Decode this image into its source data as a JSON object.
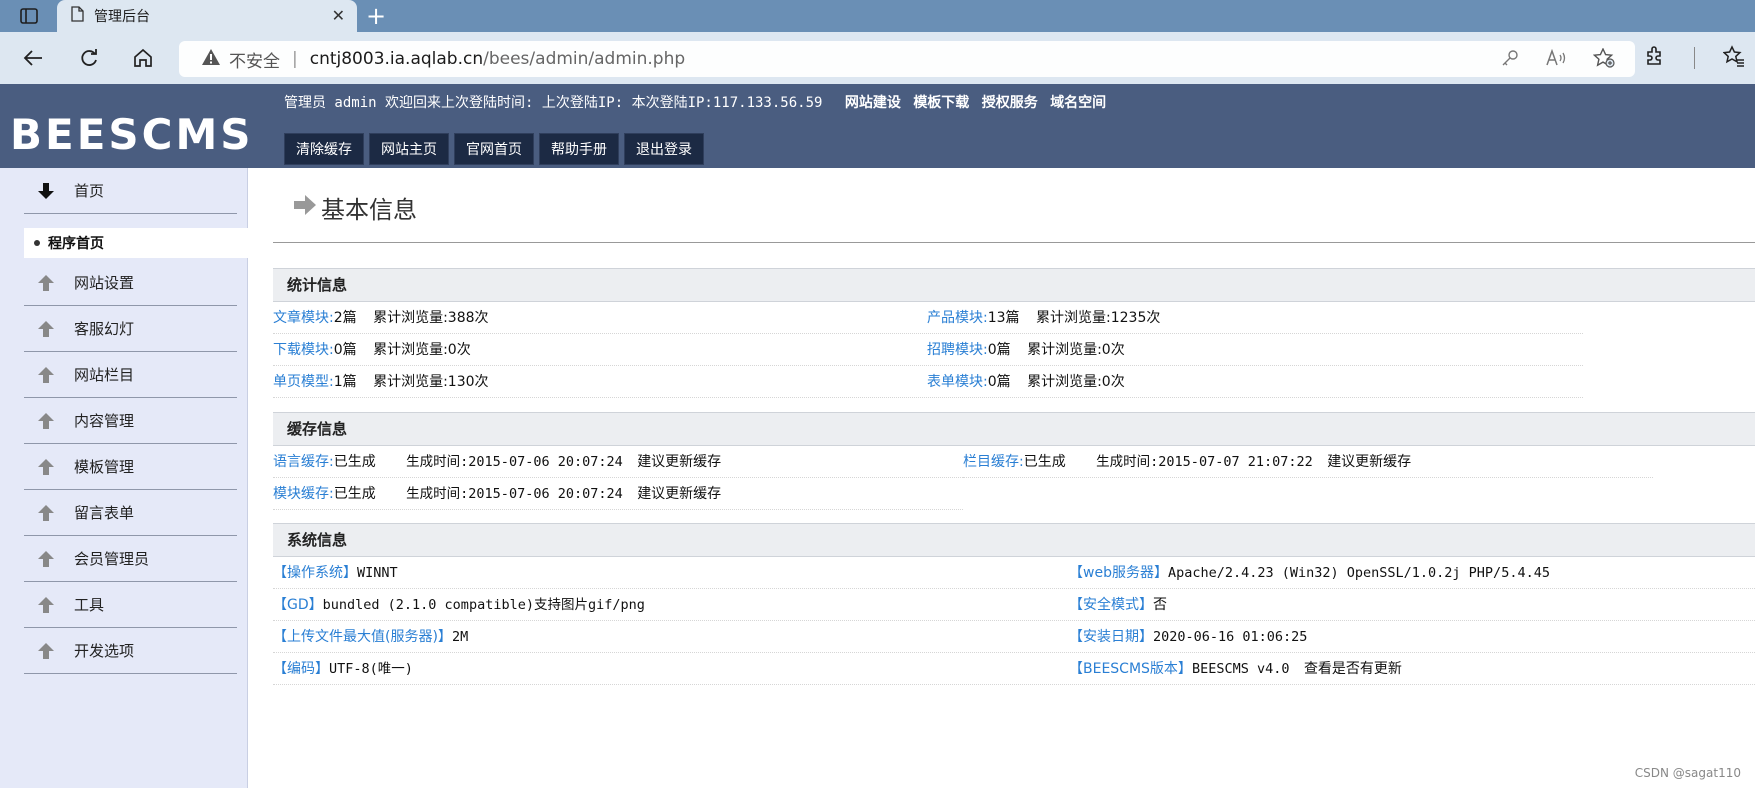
{
  "browser": {
    "tab_title": "管理后台",
    "insecure_label": "不安全",
    "url_host": "cntj8003.ia.aqlab.cn",
    "url_path": "/bees/admin/admin.php",
    "icons": [
      "sidebar-toggle-icon",
      "document-icon",
      "close-icon",
      "plus-icon",
      "back-icon",
      "reload-icon",
      "home-icon",
      "warning-icon",
      "key-icon",
      "read-aloud-icon",
      "favorite-add-icon",
      "extensions-icon",
      "favorites-icon"
    ]
  },
  "header": {
    "logo": "BEESCMS",
    "info_text": "管理员 admin 欢迎回来上次登陆时间: 上次登陆IP: 本次登陆IP:117.133.56.59",
    "links": [
      "网站建设",
      "模板下载",
      "授权服务",
      "域名空间"
    ],
    "buttons": [
      "清除缓存",
      "网站主页",
      "官网首页",
      "帮助手册",
      "退出登录"
    ],
    "bg_color": "#4a5d80"
  },
  "sidebar": {
    "home": "首页",
    "sub_home": "程序首页",
    "items": [
      "网站设置",
      "客服幻灯",
      "网站栏目",
      "内容管理",
      "模板管理",
      "留言表单",
      "会员管理员",
      "工具",
      "开发选项"
    ]
  },
  "main": {
    "page_title": "基本信息",
    "stats": {
      "heading": "统计信息",
      "rows": [
        {
          "l1": "文章模块:",
          "v1": "2篇",
          "s1": "累计浏览量:388次",
          "l2": "产品模块:",
          "v2": "13篇",
          "s2": "累计浏览量:1235次"
        },
        {
          "l1": "下载模块:",
          "v1": "0篇",
          "s1": "累计浏览量:0次",
          "l2": "招聘模块:",
          "v2": "0篇",
          "s2": "累计浏览量:0次"
        },
        {
          "l1": "单页模型:",
          "v1": "1篇",
          "s1": "累计浏览量:130次",
          "l2": "表单模块:",
          "v2": "0篇",
          "s2": "累计浏览量:0次"
        }
      ]
    },
    "cache": {
      "heading": "缓存信息",
      "rows": [
        {
          "l1": "语言缓存:",
          "v1": "已生成",
          "t1": "生成时间:2015-07-06 20:07:24",
          "u1": "建议更新缓存",
          "l2": "栏目缓存:",
          "v2": "已生成",
          "t2": "生成时间:2015-07-07 21:07:22",
          "u2": "建议更新缓存"
        },
        {
          "l1": "模块缓存:",
          "v1": "已生成",
          "t1": "生成时间:2015-07-06 20:07:24",
          "u1": "建议更新缓存"
        }
      ]
    },
    "system": {
      "heading": "系统信息",
      "rows": [
        {
          "l1": "【操作系统】",
          "v1": "WINNT",
          "l2": "【web服务器】",
          "v2": "Apache/2.4.23 (Win32) OpenSSL/1.0.2j PHP/5.4.45"
        },
        {
          "l1": "【GD】",
          "v1": "bundled (2.1.0 compatible)支持图片gif/png",
          "l2": "【安全模式】",
          "v2": "否"
        },
        {
          "l1": "【上传文件最大值(服务器)】",
          "v1": "2M",
          "l2": "【安装日期】",
          "v2": "2020-06-16 01:06:25"
        },
        {
          "l1": "【编码】",
          "v1": "UTF-8(唯一)",
          "l2": "【BEESCMS版本】",
          "v2": "BEESCMS v4.0",
          "extra": "查看是否有更新"
        }
      ]
    }
  },
  "watermark": "CSDN @sagat110"
}
